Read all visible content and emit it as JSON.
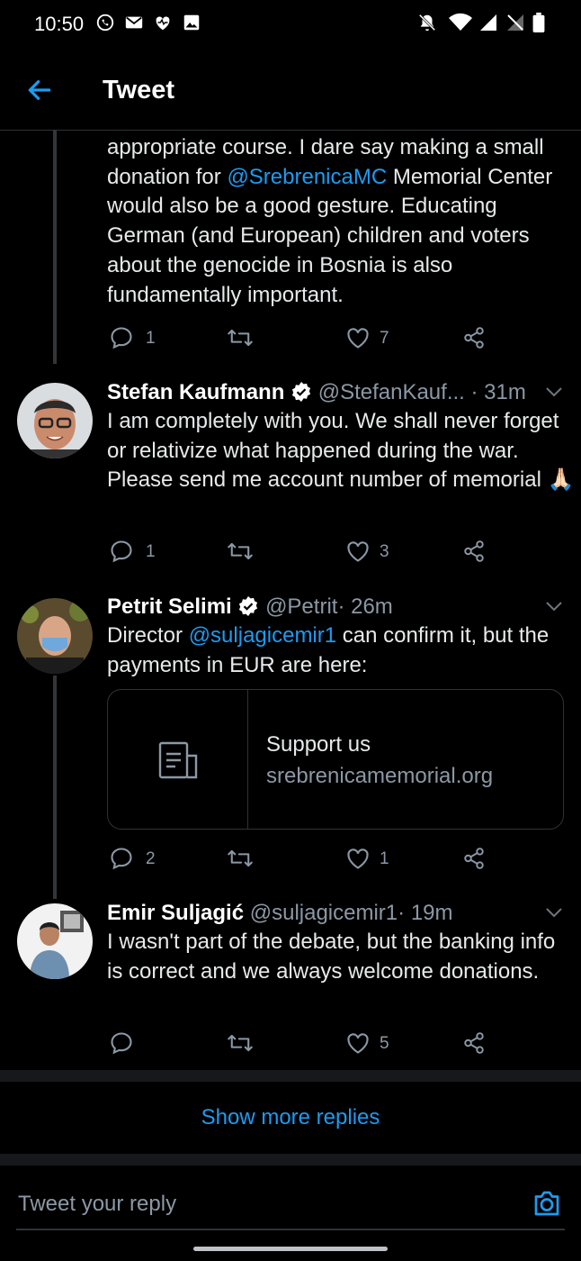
{
  "status_bar": {
    "time": "10:50"
  },
  "header": {
    "title": "Tweet"
  },
  "tweets": [
    {
      "text_parts": [
        "appropriate course. I dare say making a small donation for ",
        "@SrebrenicaMC",
        " Memorial Center would also be a good gesture. Educating German (and European) children and voters about the genocide in Bosnia is also fundamentally important."
      ],
      "replies": "1",
      "retweets": "",
      "likes": "7"
    },
    {
      "name": "Stefan Kaufmann",
      "handle": "@StefanKauf...",
      "time": "· 31m",
      "text": "I am completely with you. We shall never forget or relativize what happened during the war. Please send me account number of memorial 🙏🏻",
      "replies": "1",
      "retweets": "",
      "likes": "3"
    },
    {
      "name": "Petrit Selimi",
      "handle": "@Petrit",
      "time": "· 26m",
      "text_parts": [
        "Director ",
        "@suljagicemir1",
        " can confirm it, but the payments in EUR are here:"
      ],
      "card": {
        "title": "Support us",
        "domain": "srebrenicamemorial.org"
      },
      "replies": "2",
      "retweets": "",
      "likes": "1"
    },
    {
      "name": "Emir Suljagić",
      "handle": "@suljagicemir1",
      "time": "· 19m",
      "text": "I wasn't part of the debate, but the banking info is correct and we always welcome donations.",
      "replies": "",
      "retweets": "",
      "likes": "5"
    }
  ],
  "show_more": "Show more replies",
  "reply_box": {
    "placeholder": "Tweet your reply"
  },
  "colors": {
    "accent": "#1d9bf0",
    "background": "#000000",
    "muted": "#8b98a5"
  }
}
